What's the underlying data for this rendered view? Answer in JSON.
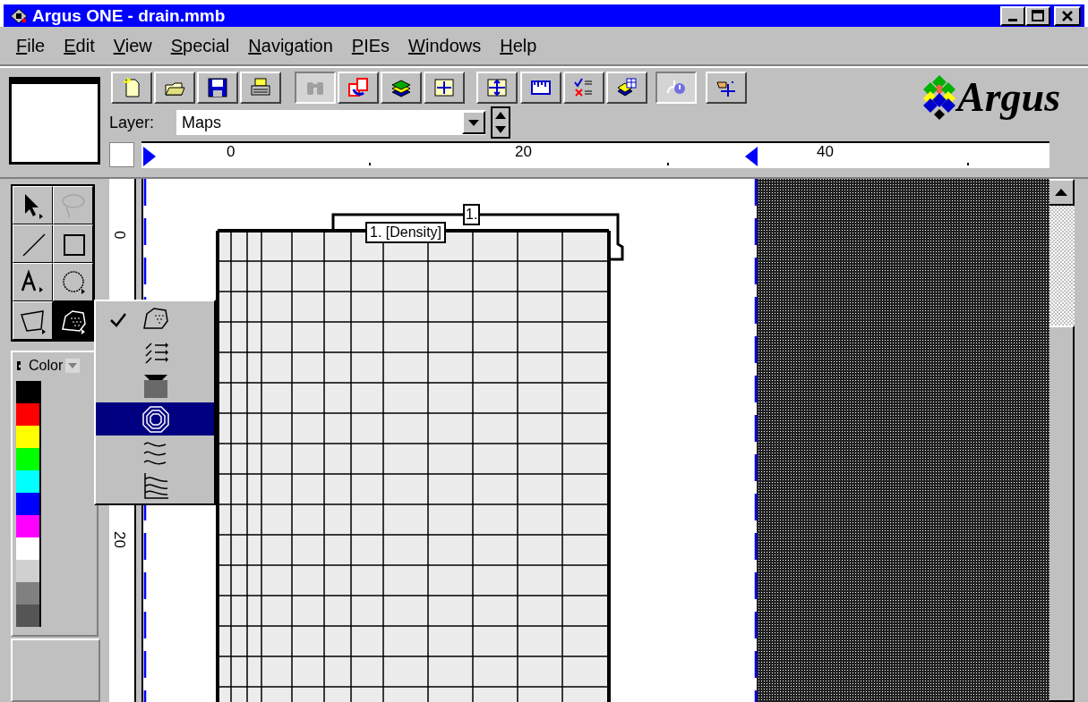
{
  "window": {
    "title": "Argus ONE - drain.mmb"
  },
  "menu": [
    "File",
    "Edit",
    "View",
    "Special",
    "Navigation",
    "PIEs",
    "Windows",
    "Help"
  ],
  "toolbar": [
    {
      "kind": "new",
      "pressed": false
    },
    {
      "kind": "open",
      "pressed": false
    },
    {
      "kind": "save",
      "pressed": false
    },
    {
      "kind": "print",
      "pressed": false
    },
    {
      "kind": "find",
      "pressed": true
    },
    {
      "kind": "redraw",
      "pressed": false
    },
    {
      "kind": "layers",
      "pressed": false
    },
    {
      "kind": "fit",
      "pressed": false
    },
    {
      "kind": "extent",
      "pressed": false
    },
    {
      "kind": "scale",
      "pressed": false
    },
    {
      "kind": "check",
      "pressed": false
    },
    {
      "kind": "table",
      "pressed": false
    },
    {
      "kind": "help",
      "pressed": true
    },
    {
      "kind": "pointer",
      "pressed": false
    }
  ],
  "layer": {
    "label": "Layer:",
    "value": "Maps"
  },
  "ruler": {
    "labels": [
      "0",
      "20",
      "40"
    ]
  },
  "vertical_ruler": {
    "labels": [
      "0",
      "20"
    ]
  },
  "logo": {
    "text": "Argus"
  },
  "tools": [
    {
      "kind": "arrow",
      "selected": false,
      "disabled": false
    },
    {
      "kind": "lasso",
      "selected": false,
      "disabled": true
    },
    {
      "kind": "line",
      "selected": false,
      "disabled": false
    },
    {
      "kind": "rectangle",
      "selected": false,
      "disabled": false
    },
    {
      "kind": "text",
      "selected": false,
      "disabled": false
    },
    {
      "kind": "oval",
      "selected": false,
      "disabled": false
    },
    {
      "kind": "polygon",
      "selected": false,
      "disabled": false
    },
    {
      "kind": "mesh",
      "selected": true,
      "disabled": false
    }
  ],
  "color_panel": {
    "label": "Color",
    "swatches": [
      {
        "color": "#000000"
      },
      {
        "color": "#ff0000"
      },
      {
        "color": "#ffff00"
      },
      {
        "color": "#00ff00"
      },
      {
        "color": "#00ffff"
      },
      {
        "color": "#0000ff"
      },
      {
        "color": "#ff00ff"
      },
      {
        "color": "#ffffff"
      },
      {
        "color": "#d0d0d0"
      },
      {
        "color": "#808080"
      },
      {
        "color": "#555555"
      }
    ]
  },
  "popup_menu": [
    {
      "kind": "region",
      "checked": true,
      "selected": false
    },
    {
      "kind": "vectors",
      "checked": false,
      "selected": false
    },
    {
      "kind": "gradient",
      "checked": false,
      "selected": false
    },
    {
      "kind": "contours",
      "checked": false,
      "selected": true
    },
    {
      "kind": "streams",
      "checked": false,
      "selected": false
    },
    {
      "kind": "profile",
      "checked": false,
      "selected": false
    }
  ],
  "canvas": {
    "labels": [
      {
        "kind": "layer-tag",
        "text": "1."
      },
      {
        "kind": "cell-tag",
        "text": "1. [Density]"
      }
    ]
  }
}
